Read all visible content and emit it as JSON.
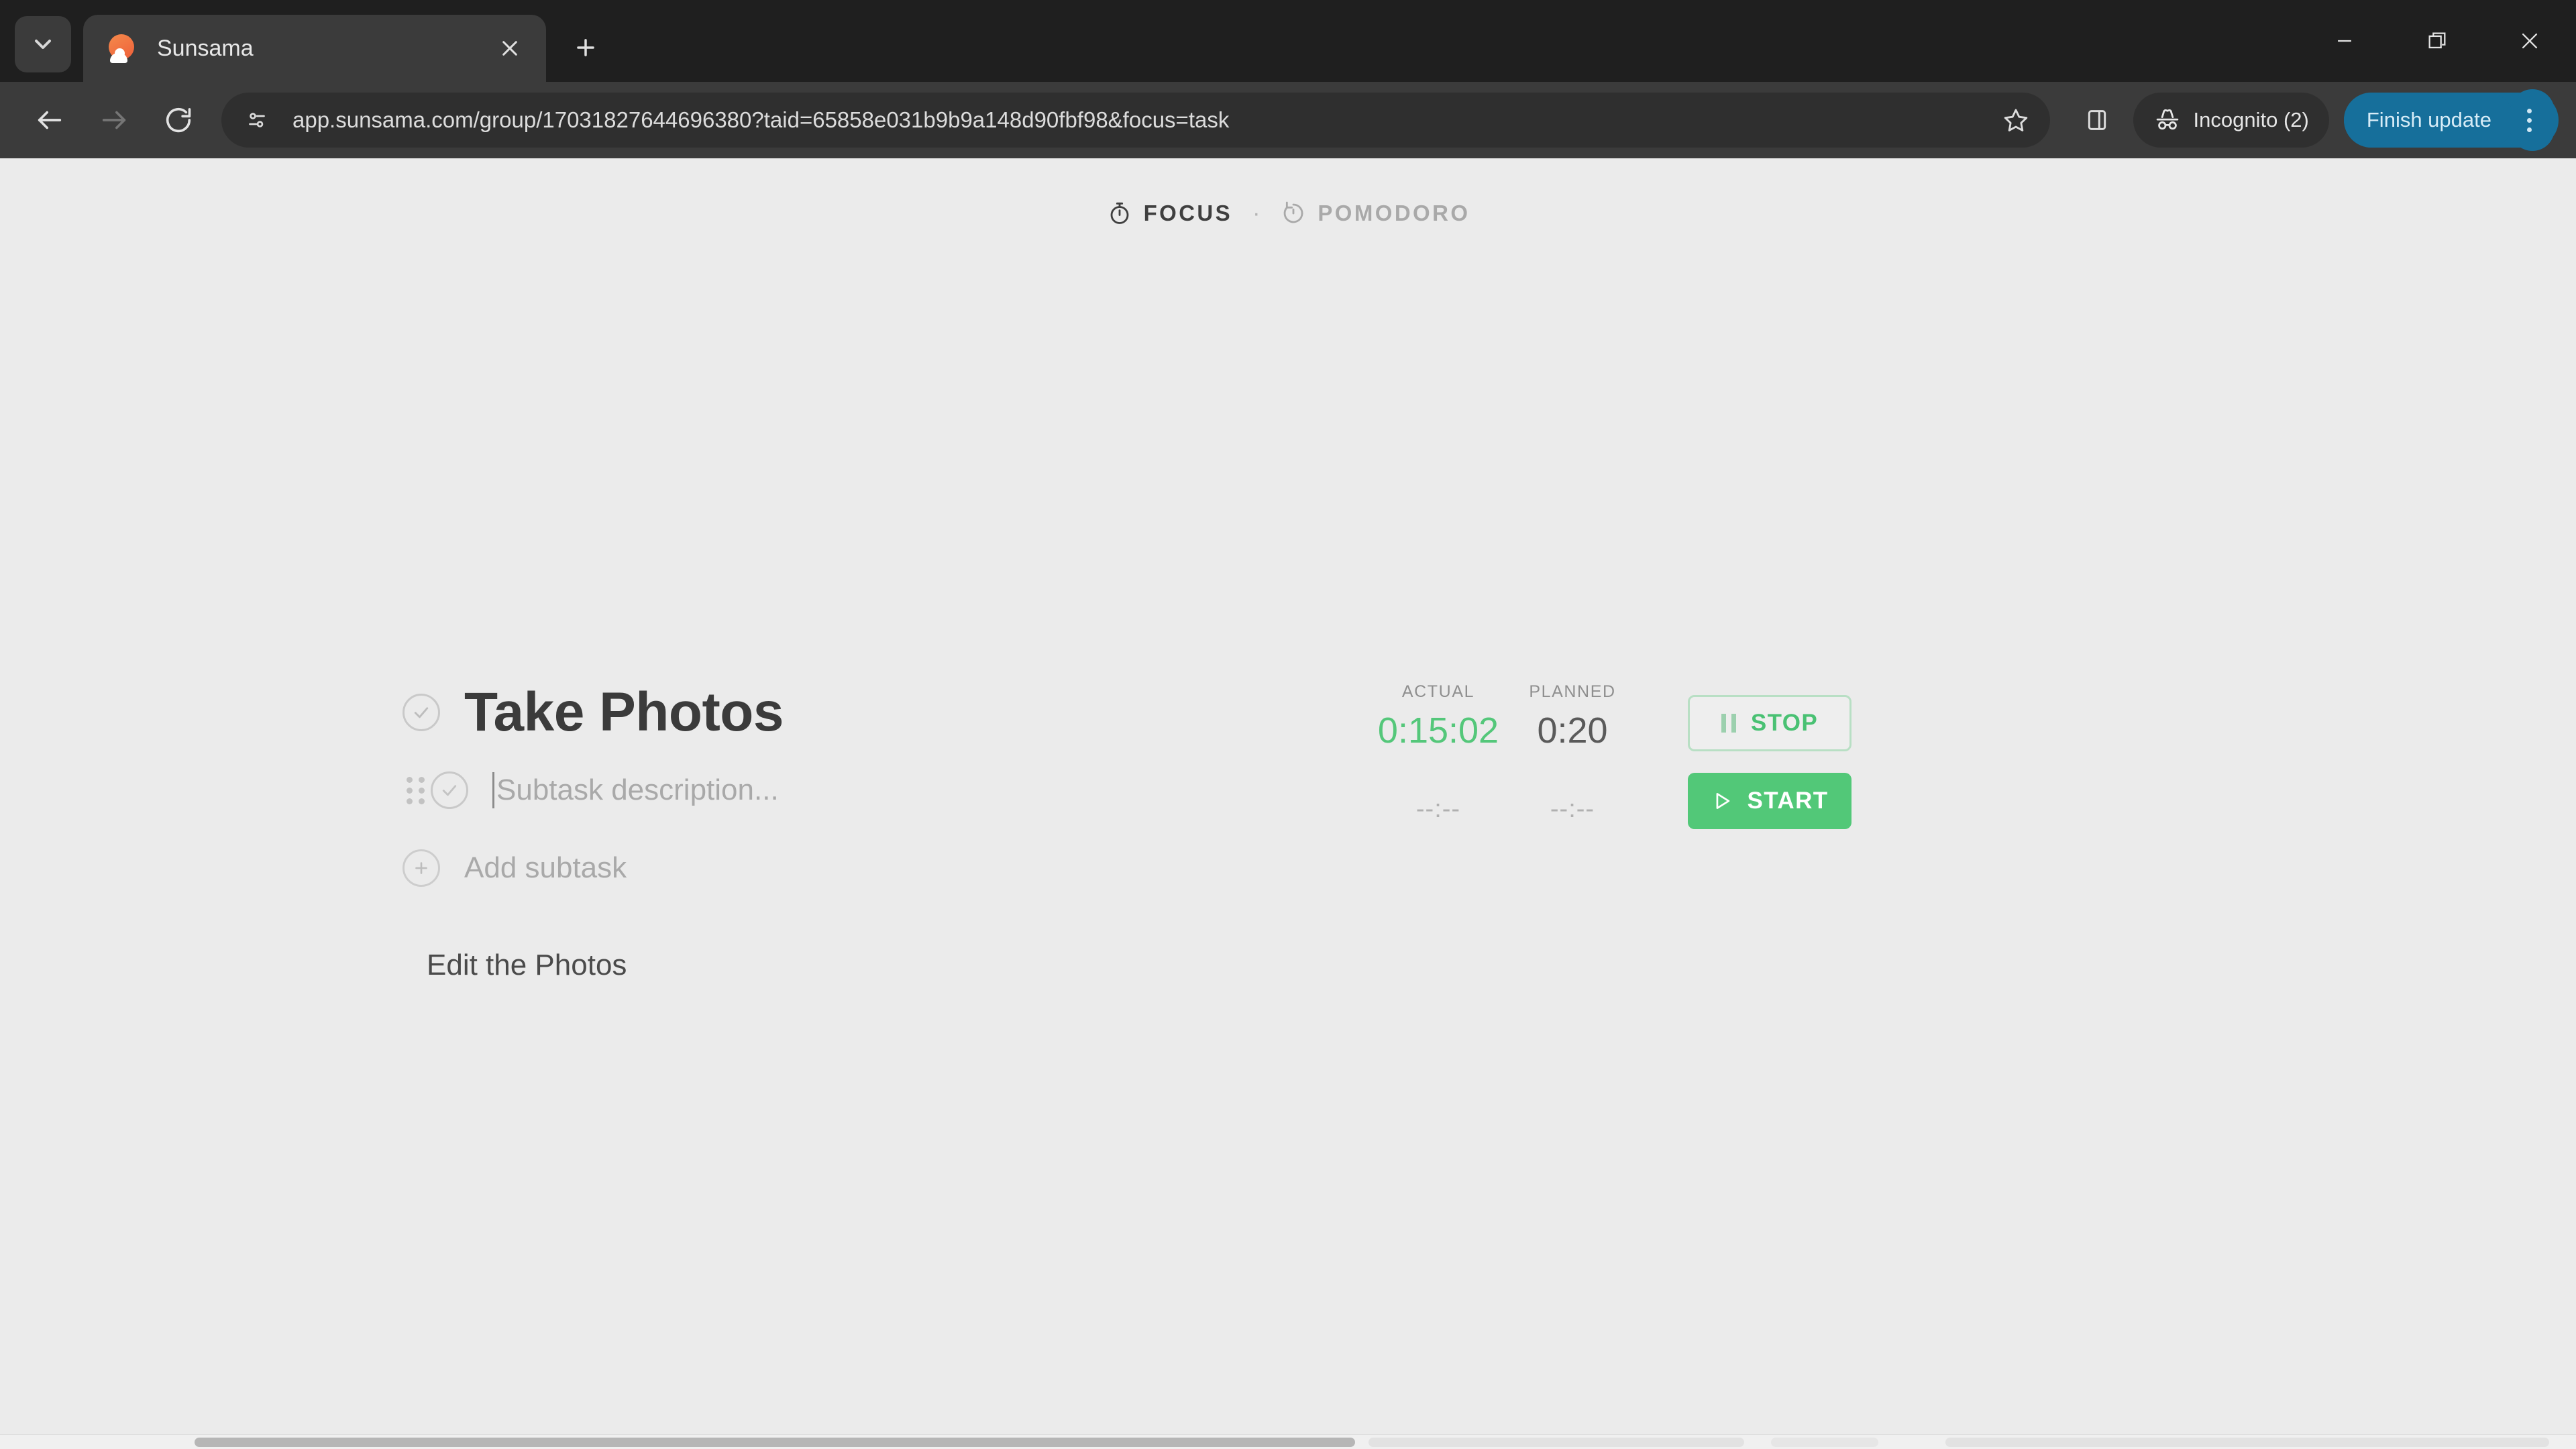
{
  "browser": {
    "tab_search_icon": "chevron-down-icon",
    "tab": {
      "title": "Sunsama",
      "favicon": "sunsama-sun-cloud-icon",
      "close_icon": "close-icon"
    },
    "new_tab_icon": "plus-icon",
    "window_controls": {
      "minimize": "minimize-icon",
      "restore": "restore-icon",
      "close": "close-icon"
    },
    "toolbar": {
      "back_icon": "back-arrow-icon",
      "forward_icon": "forward-arrow-icon",
      "reload_icon": "reload-icon",
      "site_settings_icon": "tune-sliders-icon",
      "url": "app.sunsama.com/group/17031827644696380?taid=65858e031b9b9a148d90fbf98&focus=task",
      "url_placeholder": "Search Google or type a URL",
      "bookmark_icon": "star-icon",
      "side_panel_icon": "side-panel-icon",
      "incognito_label": "Incognito (2)",
      "incognito_icon": "incognito-hat-glasses-icon",
      "update_button_label": "Finish update",
      "update_button_color": "#166f9b",
      "menu_icon": "three-dots-vertical-icon"
    }
  },
  "page": {
    "modes": [
      {
        "label": "FOCUS",
        "icon": "stopwatch-icon",
        "active": true
      },
      {
        "label": "POMODORO",
        "icon": "pomodoro-timer-icon",
        "active": false
      }
    ],
    "mode_separator": "·",
    "task": {
      "title": "Take Photos",
      "check_icon": "check-circle-icon",
      "actual_caption": "ACTUAL",
      "planned_caption": "PLANNED",
      "actual_value": "0:15:02",
      "planned_value": "0:20",
      "actual_color": "#54c77a",
      "stop_label": "STOP",
      "stop_icon": "pause-icon"
    },
    "subtask": {
      "drag_icon": "drag-handle-icon",
      "check_icon": "check-circle-icon",
      "placeholder": "Subtask description...",
      "value": "",
      "actual_value": "--:--",
      "planned_value": "--:--",
      "start_label": "START",
      "start_icon": "play-icon",
      "start_color": "#52c878"
    },
    "add_subtask": {
      "label": "Add subtask",
      "icon": "plus-circle-icon"
    },
    "notes": "Edit the Photos"
  }
}
